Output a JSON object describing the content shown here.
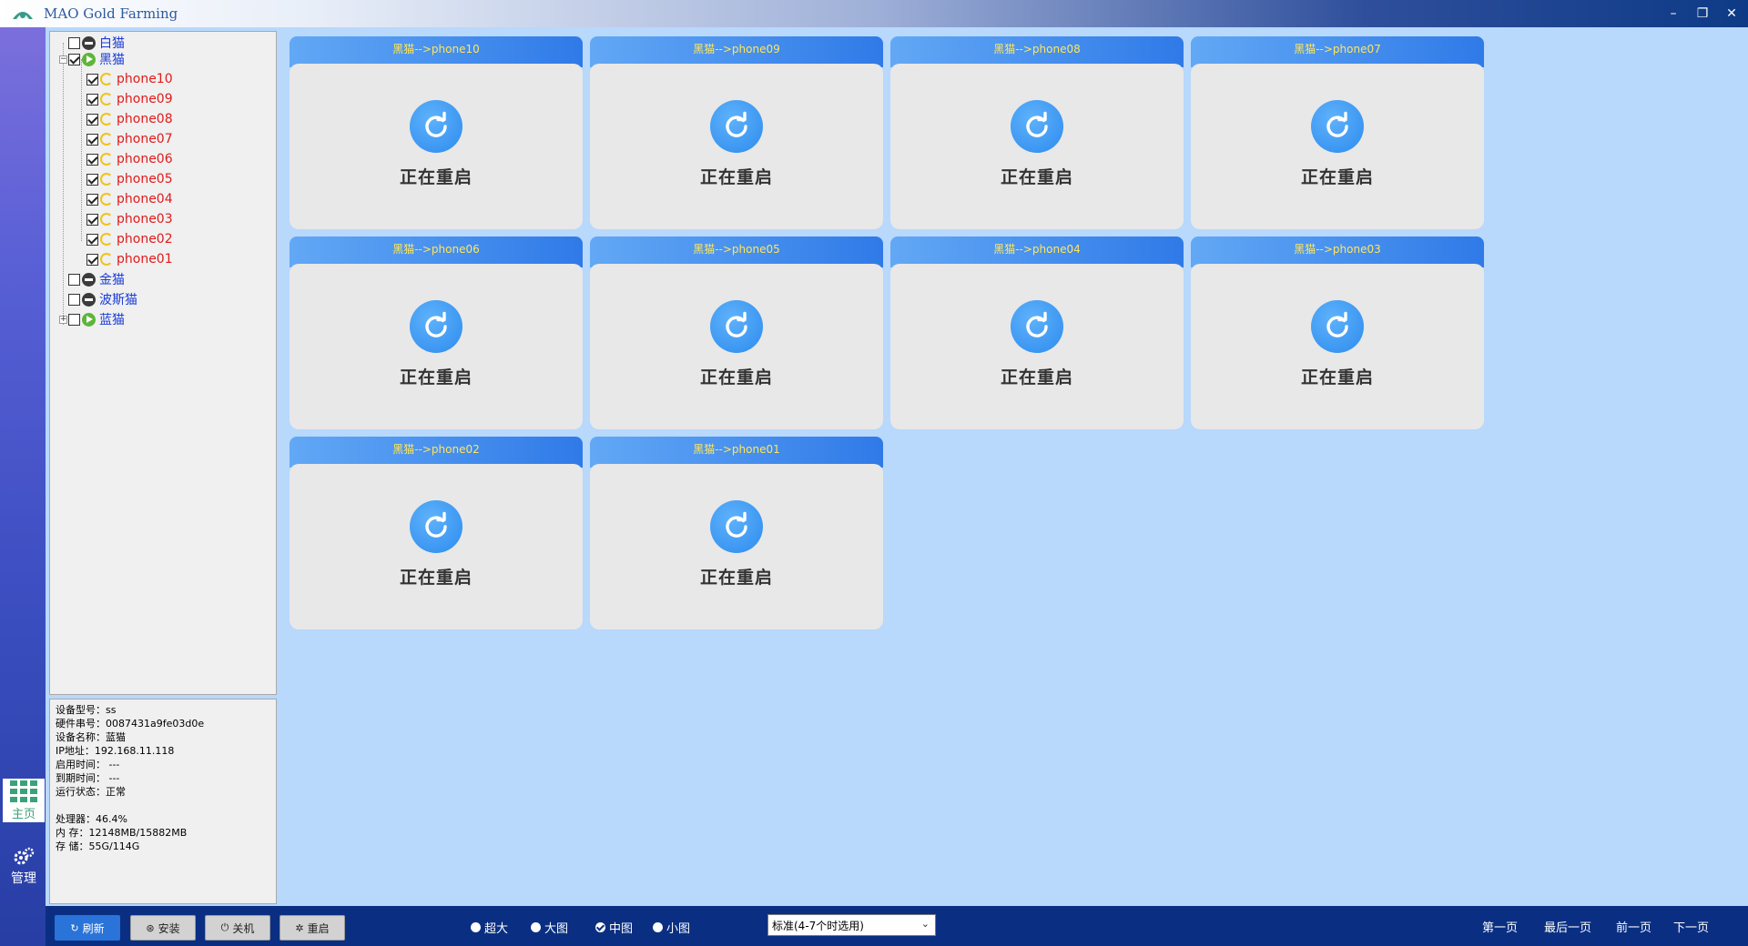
{
  "window": {
    "title": "MAO Gold Farming",
    "minimize_label": "–",
    "restore_label": "❐",
    "close_label": "✕"
  },
  "leftnav": {
    "home_label": "主页",
    "manage_label": "管理"
  },
  "tree": {
    "groups": [
      {
        "label": "白猫",
        "checked": false,
        "status": "stop"
      },
      {
        "label": "黑猫",
        "checked": true,
        "status": "run",
        "expanded": true,
        "children": [
          "phone10",
          "phone09",
          "phone08",
          "phone07",
          "phone06",
          "phone05",
          "phone04",
          "phone03",
          "phone02",
          "phone01"
        ]
      },
      {
        "label": "金猫",
        "checked": false,
        "status": "stop"
      },
      {
        "label": "波斯猫",
        "checked": false,
        "status": "stop"
      },
      {
        "label": "蓝猫",
        "checked": false,
        "status": "run"
      }
    ]
  },
  "info": {
    "model": "设备型号：ss",
    "serial": "硬件串号：0087431a9fe03d0e",
    "name": "设备名称：蓝猫",
    "ip": " IP地址：192.168.11.118",
    "start_time": "启用时间：  ---",
    "expire_time": "到期时间：  ---",
    "state": "运行状态：正常",
    "cpu": "处理器：46.4%",
    "memory": "内  存：12148MB/15882MB",
    "storage": "存  储：55G/114G"
  },
  "cards": [
    {
      "title": "黑猫-->phone10",
      "status": "正在重启"
    },
    {
      "title": "黑猫-->phone09",
      "status": "正在重启"
    },
    {
      "title": "黑猫-->phone08",
      "status": "正在重启"
    },
    {
      "title": "黑猫-->phone07",
      "status": "正在重启"
    },
    {
      "title": "黑猫-->phone06",
      "status": "正在重启"
    },
    {
      "title": "黑猫-->phone05",
      "status": "正在重启"
    },
    {
      "title": "黑猫-->phone04",
      "status": "正在重启"
    },
    {
      "title": "黑猫-->phone03",
      "status": "正在重启"
    },
    {
      "title": "黑猫-->phone02",
      "status": "正在重启"
    },
    {
      "title": "黑猫-->phone01",
      "status": "正在重启"
    }
  ],
  "toolbar": {
    "refresh": "刷新",
    "install": "安装",
    "shutdown": "关机",
    "reboot": "重启"
  },
  "view_sizes": [
    {
      "label": "超大",
      "selected": false
    },
    {
      "label": "大图",
      "selected": false
    },
    {
      "label": "中图",
      "selected": true
    },
    {
      "label": "小图",
      "selected": false
    }
  ],
  "mode_select": {
    "value": "标准(4-7个时选用)"
  },
  "pager": {
    "first": "第一页",
    "last": "最后一页",
    "prev": "前一页",
    "next": "下一页"
  }
}
